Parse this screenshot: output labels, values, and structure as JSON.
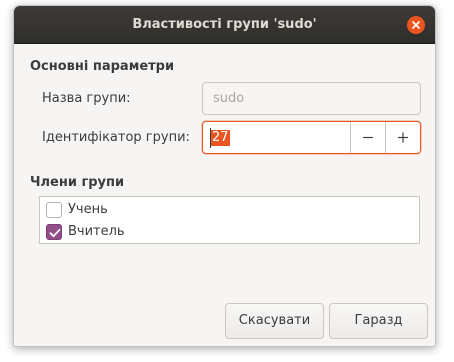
{
  "window": {
    "title": "Властивості групи 'sudo'"
  },
  "basic_section": {
    "heading": "Основні параметри",
    "group_name_label": "Назва групи:",
    "group_name_value": "sudo",
    "group_id_label": "Ідентифікатор групи:",
    "group_id_value": "27"
  },
  "members_section": {
    "heading": "Члени групи",
    "members": [
      {
        "label": "Учень",
        "checked": false
      },
      {
        "label": "Вчитель",
        "checked": true
      }
    ]
  },
  "buttons": {
    "cancel_label": "Скасувати",
    "ok_label": "Гаразд"
  },
  "colors": {
    "accent": "#e95420",
    "checkbox_checked": "#924d8b",
    "titlebar": "#3d3b37"
  },
  "icons": {
    "close": "close-icon",
    "minus": "minus-icon",
    "plus": "plus-icon",
    "check": "checkmark-icon"
  }
}
